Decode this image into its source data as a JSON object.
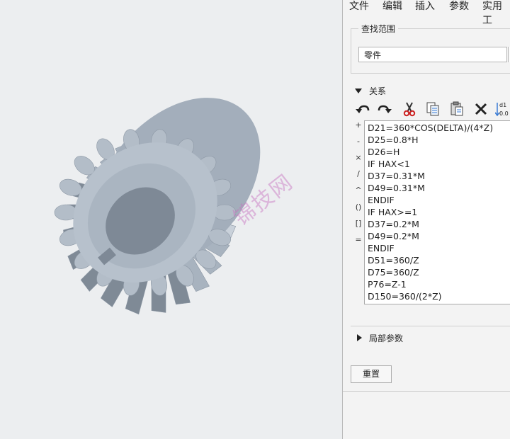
{
  "menu": {
    "items": [
      "文件",
      "编辑",
      "插入",
      "参数",
      "实用工"
    ]
  },
  "search": {
    "legend": "查找范围",
    "scope_value": "零件"
  },
  "relations": {
    "header": "关系",
    "toolbar_icons": [
      "undo-icon",
      "redo-icon",
      "cut-icon",
      "copy-icon",
      "paste-icon",
      "delete-icon",
      "sort-relations-icon"
    ],
    "operators": [
      "+",
      "-",
      "×",
      "/",
      "^",
      "()",
      "[]",
      "="
    ],
    "lines": [
      "D21=360*COS(DELTA)/(4*Z)",
      "D25=0.8*H",
      "D26=H",
      "IF HAX<1",
      "D37=0.31*M",
      "D49=0.31*M",
      "ENDIF",
      "IF HAX>=1",
      "D37=0.2*M",
      "D49=0.2*M",
      "ENDIF",
      "D51=360/Z",
      "D75=360/Z",
      "P76=Z-1",
      "D150=360/(2*Z)"
    ]
  },
  "local_params": {
    "label": "局部参数"
  },
  "reset_label": "重置",
  "watermark": "锦技网",
  "colors": {
    "gear_light": "#c9d1da",
    "gear_mid": "#a8b3bf",
    "gear_dark": "#7f8a96",
    "viewport_bg": "#eceef0"
  }
}
